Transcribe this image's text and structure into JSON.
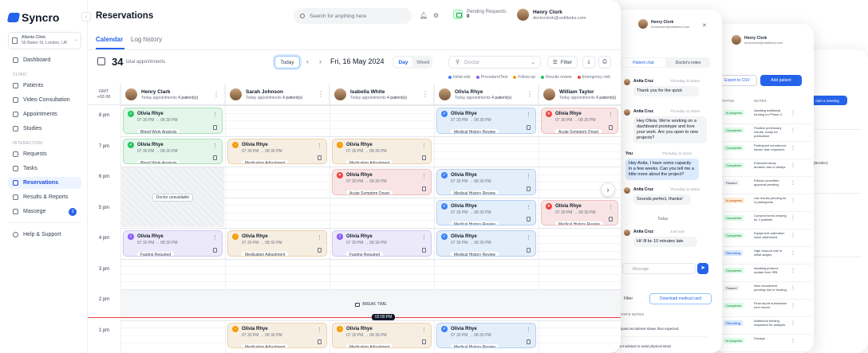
{
  "app": {
    "name": "Syncro",
    "page_title": "Reservations"
  },
  "clinic": {
    "name": "Atlanta Clinic",
    "address": "56 Baker St, London, UK"
  },
  "sidebar": {
    "sections": [
      "CLINIC",
      "INTERACTION"
    ],
    "items": [
      {
        "label": "Dashboard"
      },
      {
        "label": "Patients"
      },
      {
        "label": "Video Consultation"
      },
      {
        "label": "Appointments"
      },
      {
        "label": "Studies"
      },
      {
        "label": "Requests"
      },
      {
        "label": "Tasks"
      },
      {
        "label": "Reservations"
      },
      {
        "label": "Results & Reports"
      },
      {
        "label": "Massege",
        "badge": "3"
      },
      {
        "label": "Help & Support"
      }
    ]
  },
  "header": {
    "search_placeholder": "Search for anything here",
    "pending_label": "Pending Requests:",
    "pending_count": "0",
    "user_name": "Henry Clork",
    "user_email": "doctorclork@untitledui.com"
  },
  "tabs": [
    "Calendar",
    "Log history"
  ],
  "toolbar": {
    "count": "34",
    "count_label": "total appointments",
    "today": "Today",
    "date": "Fri, 16 May 2024",
    "view_day": "Day",
    "view_week": "Week",
    "doctor_placeholder": "Doctor",
    "filter": "Filter"
  },
  "legend": [
    {
      "label": "Initial visit",
      "color": "#3b82f6"
    },
    {
      "label": "Procedure/Test",
      "color": "#8b5cf6"
    },
    {
      "label": "Follow-up",
      "color": "#f59e0b"
    },
    {
      "label": "Results review",
      "color": "#22c55e"
    },
    {
      "label": "Emergency visit",
      "color": "#ef4444"
    }
  ],
  "grid": {
    "gmt": "GMT",
    "gmt_offset": "+03 00",
    "hours": [
      "8 pm",
      "7 pm",
      "6 pm",
      "5 pm",
      "4 pm",
      "3 pm",
      "2 pm",
      "1 pm"
    ],
    "unavailable": "Doctor unavailable",
    "break": "BREAK TIME",
    "now": "02:00 PM",
    "doctors": [
      {
        "name": "Henry Clark",
        "today": "Today appointments",
        "count": "4 patient(s)"
      },
      {
        "name": "Sarah Johnson",
        "today": "Today appointments",
        "count": "4 patient(s)"
      },
      {
        "name": "Isabella White",
        "today": "Today appointments",
        "count": "4 patient(s)"
      },
      {
        "name": "Olivia Rhye",
        "today": "Today appointments",
        "count": "4 patient(s)"
      },
      {
        "name": "William Taylor",
        "today": "Today appointments",
        "count": "4 patient(s)"
      }
    ]
  },
  "appointments": [
    {
      "col": 0,
      "slot": 0,
      "type": "green",
      "patient": "Olivia Rhye",
      "time": "07 30 PM → 08 30 PM",
      "tag": "Blood Work Analysis"
    },
    {
      "col": 0,
      "slot": 1,
      "type": "green",
      "patient": "Olivia Rhye",
      "time": "07 30 PM → 08 30 PM",
      "tag": "Blood Work Analysis"
    },
    {
      "col": 0,
      "slot": 4,
      "type": "purple",
      "patient": "Olivia Rhye",
      "time": "07 30 PM → 08 30 PM",
      "tag": "Fasting Required"
    },
    {
      "col": 1,
      "slot": 1,
      "type": "orange",
      "patient": "Olivia Rhye",
      "time": "07 30 PM → 08 30 PM",
      "tag": "Medication Adjustment"
    },
    {
      "col": 1,
      "slot": 4,
      "type": "orange",
      "patient": "Olivia Rhye",
      "time": "07 30 PM → 08 30 PM",
      "tag": "Medication Adjustment"
    },
    {
      "col": 1,
      "slot": 7,
      "type": "orange",
      "patient": "Olivia Rhye",
      "time": "07 30 PM → 08 30 PM",
      "tag": "Medication Adjustment"
    },
    {
      "col": 2,
      "slot": 1,
      "type": "orange",
      "patient": "Olivia Rhye",
      "time": "07 30 PM → 08 30 PM",
      "tag": "Medication Adjustment"
    },
    {
      "col": 2,
      "slot": 2,
      "type": "red",
      "patient": "Olivia Rhye",
      "time": "07 30 PM → 08 30 PM",
      "tag": "Acute Symptom Onset"
    },
    {
      "col": 2,
      "slot": 4,
      "type": "purple",
      "patient": "Olivia Rhye",
      "time": "07 30 PM → 08 30 PM",
      "tag": "Fasting Required"
    },
    {
      "col": 2,
      "slot": 7,
      "type": "orange",
      "patient": "Olivia Rhye",
      "time": "07 30 PM → 08 30 PM",
      "tag": "Medication Adjustment"
    },
    {
      "col": 3,
      "slot": 0,
      "type": "blue",
      "patient": "Olivia Rhye",
      "time": "07 30 PM → 08 30 PM",
      "tag": "Medical History Review"
    },
    {
      "col": 3,
      "slot": 2,
      "type": "blue",
      "patient": "Olivia Rhye",
      "time": "07 30 PM → 08 30 PM",
      "tag": "Medical History Review"
    },
    {
      "col": 3,
      "slot": 3,
      "type": "blue",
      "patient": "Olivia Rhye",
      "time": "07 30 PM → 08 30 PM",
      "tag": "Medical History Review"
    },
    {
      "col": 3,
      "slot": 4,
      "type": "blue",
      "patient": "Olivia Rhye",
      "time": "07 30 PM → 08 30 PM",
      "tag": "Medical History Review"
    },
    {
      "col": 3,
      "slot": 7,
      "type": "blue",
      "patient": "Olivia Rhye",
      "time": "07 30 PM → 08 30 PM",
      "tag": "Medical History Review"
    },
    {
      "col": 4,
      "slot": 0,
      "type": "red",
      "patient": "Olivia Rhye",
      "time": "07 30 PM → 08 30 PM",
      "tag": "Acute Symptom Onset"
    },
    {
      "col": 4,
      "slot": 3,
      "type": "red",
      "patient": "Olivia Rhye",
      "time": "07 30 PM → 08 30 PM",
      "tag": "Medical History Review"
    }
  ],
  "chat": {
    "user_name": "Henry Clork",
    "user_email": "doctorclork@untitledui.com",
    "tab_chat": "Patient chat",
    "tab_notes": "Doctor's notes",
    "messages": [
      {
        "from": "Anita Cruz",
        "time": "Thursday 11:40am",
        "text": "Thank you for the quick"
      },
      {
        "from": "Anita Cruz",
        "time": "Thursday 11:40am",
        "text": "Hey Olivia. We're working on a dashboard prototype and love your work. Are you open to new projects?"
      },
      {
        "from": "You",
        "time": "Thursday 11:41am",
        "text": "Hey Anita, I have some capacity in a few weeks. Can you tell me a little more about the project?"
      },
      {
        "from": "Anita Cruz",
        "time": "Thursday 11:40am",
        "text": "Sounds perfect, thanks!"
      },
      {
        "from": "Anita Cruz",
        "time": "Just now",
        "text": "Hi! Ill bc 10 minutes late"
      }
    ],
    "divider": "Today",
    "message_placeholder": "Message",
    "filter": "Filter",
    "download": "Download medical card",
    "notes_header": "CTOR'S NOTES",
    "note1": "ticipant recruitment slower than expected.",
    "note2": "tient advised to avoid physical strain"
  },
  "study": {
    "user_name": "Henry Clork",
    "user_email": "doctorclork@untitledui.com",
    "export": "Export to CSV",
    "add": "Add patient",
    "col_status": "STATUS",
    "col_notes": "NOTES",
    "rows": [
      {
        "status": "In progress",
        "kind": "g",
        "note": "Awaiting additional funding for Phase II."
      },
      {
        "status": "Completed",
        "kind": "g",
        "note": "Positive preliminary results, ready for publication."
      },
      {
        "status": "Completed",
        "kind": "g",
        "note": "Participant recruitment slower than expected."
      },
      {
        "status": "Completed",
        "kind": "g",
        "note": "Extended study duration due to delays."
      },
      {
        "status": "Paused",
        "kind": "p",
        "note": "Ethical committee approval pending."
      },
      {
        "status": "In progress",
        "kind": "o",
        "note": "Lab results pending for 3 participants."
      },
      {
        "status": "Completed",
        "kind": "g",
        "note": "Consent forms missing for 2 patients."
      },
      {
        "status": "Completed",
        "kind": "g",
        "note": "Equipment calibration issue addressed."
      },
      {
        "status": "Recruiting",
        "kind": "b",
        "note": "High dropout rate in initial stages."
      },
      {
        "status": "Completed",
        "kind": "g",
        "note": "Awaiting protocol update from IRB."
      },
      {
        "status": "Paused",
        "kind": "p",
        "note": "New recruitment pending due to funding."
      },
      {
        "status": "Completed",
        "kind": "g",
        "note": "Final report submission next month."
      },
      {
        "status": "Recruiting",
        "kind": "b",
        "note": "Additional funding requested for analysis."
      },
      {
        "status": "In progress",
        "kind": "g",
        "note": "Dosage..."
      }
    ]
  },
  "schedule": {
    "button": "dule a meeting",
    "snippet": "(Brother)"
  }
}
